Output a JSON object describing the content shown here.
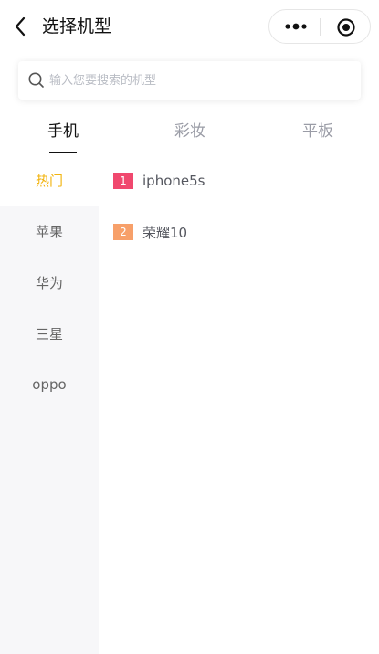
{
  "nav": {
    "title": "选择机型",
    "back_icon": "chevron-left-icon",
    "more_icon": "more-dots-icon",
    "target_icon": "target-icon"
  },
  "search": {
    "placeholder": "输入您要搜索的机型",
    "value": ""
  },
  "tabs": [
    {
      "label": "手机",
      "active": true
    },
    {
      "label": "彩妆",
      "active": false
    },
    {
      "label": "平板",
      "active": false
    }
  ],
  "sidebar": {
    "items": [
      {
        "label": "热门",
        "active": true
      },
      {
        "label": "苹果",
        "active": false
      },
      {
        "label": "华为",
        "active": false
      },
      {
        "label": "三星",
        "active": false
      },
      {
        "label": "oppo",
        "active": false
      }
    ]
  },
  "models": [
    {
      "rank": "1",
      "name": "iphone5s",
      "rank_color": "#f0486e"
    },
    {
      "rank": "2",
      "name": "荣耀10",
      "rank_color": "#f7a06a"
    }
  ],
  "colors": {
    "accent": "#f2b410",
    "sidebar_bg": "#f7f7f9"
  }
}
